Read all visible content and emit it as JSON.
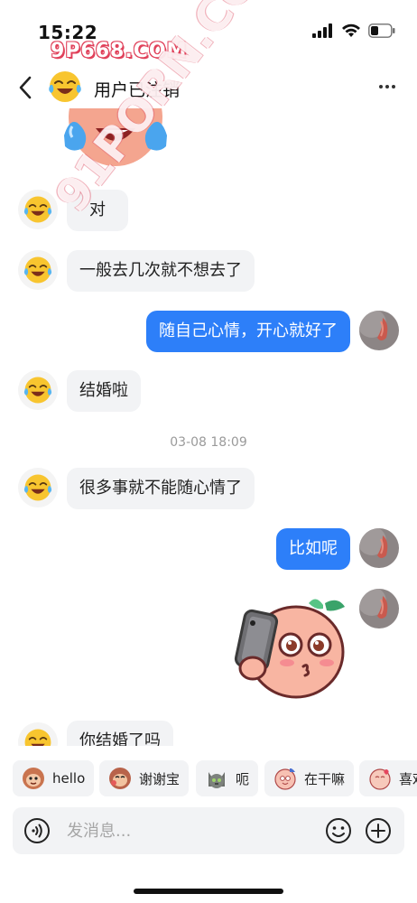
{
  "status_bar": {
    "time": "15:22",
    "icons": [
      "signal-icon",
      "wifi-icon",
      "battery-icon"
    ]
  },
  "watermarks": {
    "top": "9P668.COM",
    "diagonal": "91PORN.COM"
  },
  "header": {
    "title": "用户已注销",
    "back_icon": "chevron-left-icon",
    "more_icon": "more-dots-icon"
  },
  "messages": [
    {
      "side": "left",
      "text": "对"
    },
    {
      "side": "left",
      "text": "一般去几次就不想去了"
    },
    {
      "side": "right",
      "text": "随自己心情，开心就好了"
    },
    {
      "side": "left",
      "text": "结婚啦"
    },
    {
      "side": "left",
      "text": "很多事就不能随心情了"
    },
    {
      "side": "right",
      "text": "比如呢"
    },
    {
      "side": "left",
      "text": "你结婚了吗"
    }
  ],
  "timestamp": "03-08 18:09",
  "quick_replies": [
    {
      "label": "hello",
      "icon": "monkey-face-icon"
    },
    {
      "label": "谢谢宝",
      "icon": "monkey-thanks-icon"
    },
    {
      "label": "呃",
      "icon": "cat-face-icon"
    },
    {
      "label": "在干嘛",
      "icon": "peach-face-icon"
    },
    {
      "label": "喜欢",
      "icon": "heart-face-icon"
    }
  ],
  "input": {
    "placeholder": "发消息...",
    "voice_icon": "voice-icon",
    "emoji_icon": "smiley-icon",
    "plus_icon": "plus-circle-icon"
  },
  "colors": {
    "accent_blue": "#2d7ff9",
    "bubble_gray": "#f2f3f5",
    "emoji_yellow": "#f8c52f"
  }
}
